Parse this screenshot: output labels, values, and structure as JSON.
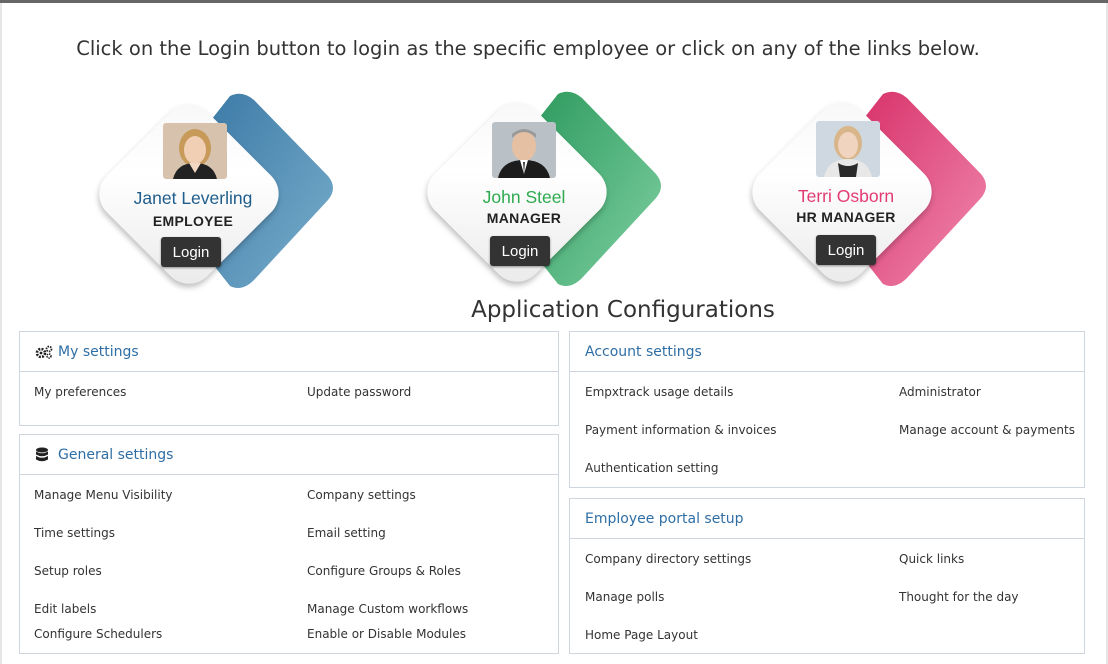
{
  "instruction": "Click on the Login button to login as the specific employee or click on any of the links below.",
  "employees": [
    {
      "name": "Janet Leverling",
      "role": "EMPLOYEE",
      "login_label": "Login",
      "accent": "#4f8bb3",
      "name_color": "#1f5d8c"
    },
    {
      "name": "John Steel",
      "role": "MANAGER",
      "login_label": "Login",
      "accent": "#3cae6e",
      "name_color": "#2eaa4e"
    },
    {
      "name": "Terri Osborn",
      "role": "HR MANAGER",
      "login_label": "Login",
      "accent": "#e1437a",
      "name_color": "#e23a72"
    }
  ],
  "section_title": "Application Configurations",
  "panels": {
    "my_settings": {
      "title": "My settings",
      "icon": "gears-icon",
      "links": [
        "My preferences",
        "Update password"
      ]
    },
    "general_settings": {
      "title": "General settings",
      "icon": "database-icon",
      "links": [
        "Manage Menu Visibility",
        "Company settings",
        "Time settings",
        "Email setting",
        "Setup roles",
        "Configure Groups & Roles",
        "Edit labels",
        "Manage Custom workflows",
        "Configure Schedulers",
        "Enable or Disable Modules"
      ]
    },
    "account_settings": {
      "title": "Account settings",
      "links": [
        "Empxtrack usage details",
        "Administrator",
        "Payment information & invoices",
        "Manage account & payments",
        "Authentication setting"
      ]
    },
    "employee_portal": {
      "title": "Employee portal setup",
      "links": [
        "Company directory settings",
        "Quick links",
        "Manage polls",
        "Thought for the day",
        "Home Page Layout"
      ]
    }
  },
  "colors": {
    "link_blue": "#2f6ea4",
    "panel_border": "#cfd6e0",
    "button_dark": "#333333"
  }
}
